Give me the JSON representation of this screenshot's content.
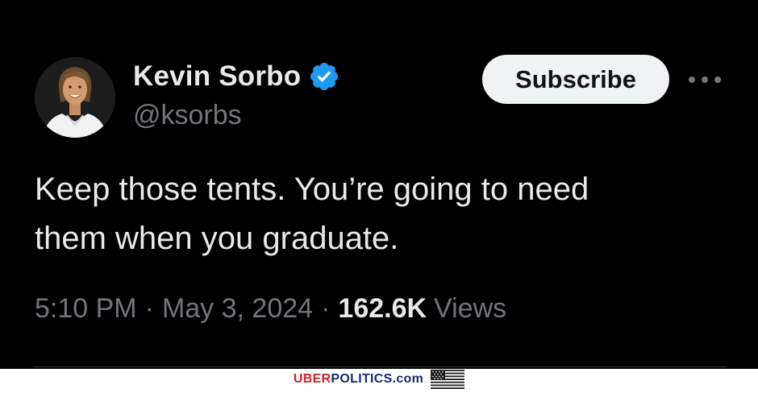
{
  "author": {
    "display_name": "Kevin Sorbo",
    "handle": "@ksorbs",
    "verified_icon": "verified-badge-icon",
    "verified_color": "#1d9bf0"
  },
  "actions": {
    "subscribe_label": "Subscribe",
    "more_icon": "more-options-icon"
  },
  "tweet": {
    "text_line1": "Keep those tents. You’re going to need",
    "text_line2": "them when you graduate.",
    "time": "5:10 PM",
    "separator": "·",
    "date": "May 3, 2024",
    "views_count": "162.6K",
    "views_label": "Views"
  },
  "footer": {
    "brand_part1": "UBER",
    "brand_part2": "POLITICS",
    "brand_part3": ".com",
    "brand_color_red": "#d0202a",
    "brand_color_blue": "#1b2a6b",
    "flag_icon": "us-flag-icon"
  }
}
